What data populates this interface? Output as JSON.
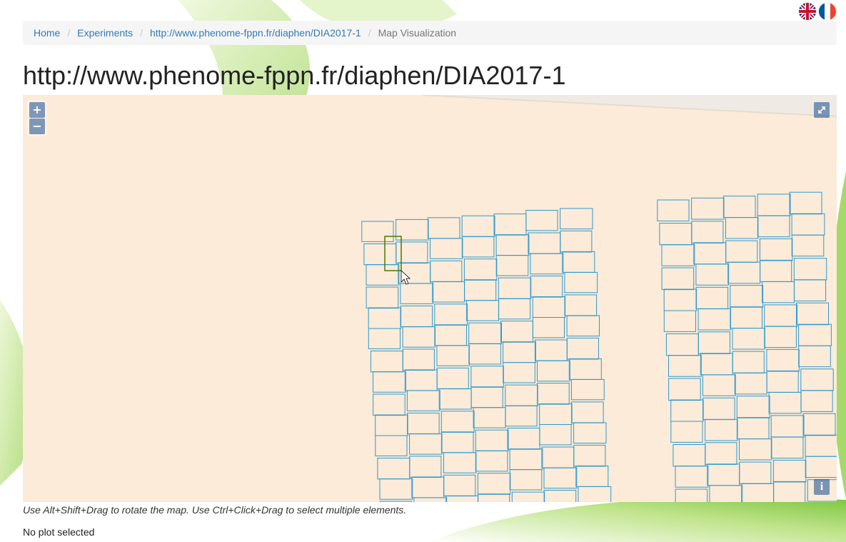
{
  "breadcrumb": {
    "home": "Home",
    "experiments": "Experiments",
    "experiment_uri": "http://www.phenome-fppn.fr/diaphen/DIA2017-1",
    "current": "Map Visualization"
  },
  "page": {
    "title": "http://www.phenome-fppn.fr/diaphen/DIA2017-1"
  },
  "map": {
    "zoom_in_label": "+",
    "zoom_out_label": "−",
    "fullscreen_icon": "expand-icon",
    "attribution_label": "i",
    "plot_stroke_color": "#3399cc",
    "selection_color": "#4a7a00",
    "background_color": "#fbebd8"
  },
  "hint": "Use Alt+Shift+Drag to rotate the map. Use Ctrl+Click+Drag to select multiple elements.",
  "status": "No plot selected",
  "languages": [
    "en-flag-icon",
    "fr-flag-icon"
  ]
}
